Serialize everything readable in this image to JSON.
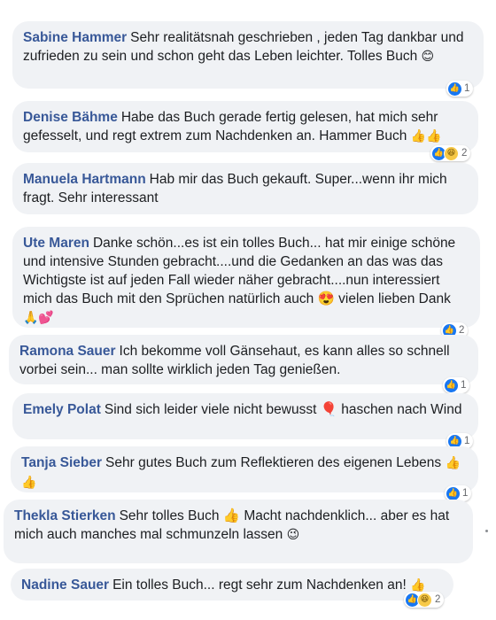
{
  "comments": [
    {
      "author": "Sabine Hammer",
      "text": "Sehr realitätsnah geschrieben , jeden Tag dankbar und zufrieden zu sein und schon geht das Leben leichter. Tolles Buch",
      "emoji": "😊",
      "reactions": "1"
    },
    {
      "author": "Denise Bähme",
      "text": "Habe das Buch gerade fertig gelesen, hat mich sehr gefesselt, und regt extrem zum Nachdenken an. Hammer Buch",
      "emoji": "👍👍",
      "reactions": "2"
    },
    {
      "author": "Manuela Hartmann",
      "text": "Hab mir das Buch gekauft. Super...wenn ihr mich fragt. Sehr interessant",
      "emoji": "",
      "reactions": ""
    },
    {
      "author": "Ute Maren",
      "text": "Danke schön...es ist ein tolles Buch... hat mir einige schöne und intensive Stunden gebracht....und die Gedanken an das was das Wichtigste ist auf jeden Fall wieder näher gebracht....nun interessiert mich das Buch mit den Sprüchen natürlich auch 😍 vielen lieben Dank",
      "emoji": "🙏💕",
      "reactions": "2"
    },
    {
      "author": "Ramona Sauer",
      "text": "Ich bekomme voll Gänsehaut, es kann alles so schnell vorbei sein... man sollte wirklich jeden Tag genießen.",
      "emoji": "",
      "reactions": "1"
    },
    {
      "author": "Emely Polat",
      "text": "Sind sich leider viele nicht bewusst 🎈 haschen nach Wind",
      "emoji": "",
      "reactions": "1"
    },
    {
      "author": "Tanja Sieber",
      "text": "Sehr gutes Buch zum Reflektieren des eigenen Lebens",
      "emoji": "👍👍",
      "reactions": "1"
    },
    {
      "author": "Thekla Stierken",
      "text": "Sehr tolles Buch 👍 Macht nachdenklich... aber es hat mich auch manches mal schmunzeln lassen",
      "emoji": "😉",
      "reactions": ""
    },
    {
      "author": "Nadine Sauer",
      "text": "Ein tolles Buch... regt sehr zum Nachdenken an!",
      "emoji": "👍",
      "reactions": "2"
    }
  ],
  "icons": {
    "like": "thumbs-up-icon",
    "haha": "haha-icon"
  },
  "colors": {
    "author": "#385898",
    "bubble": "#f0f2f5",
    "like": "#1877f2"
  }
}
